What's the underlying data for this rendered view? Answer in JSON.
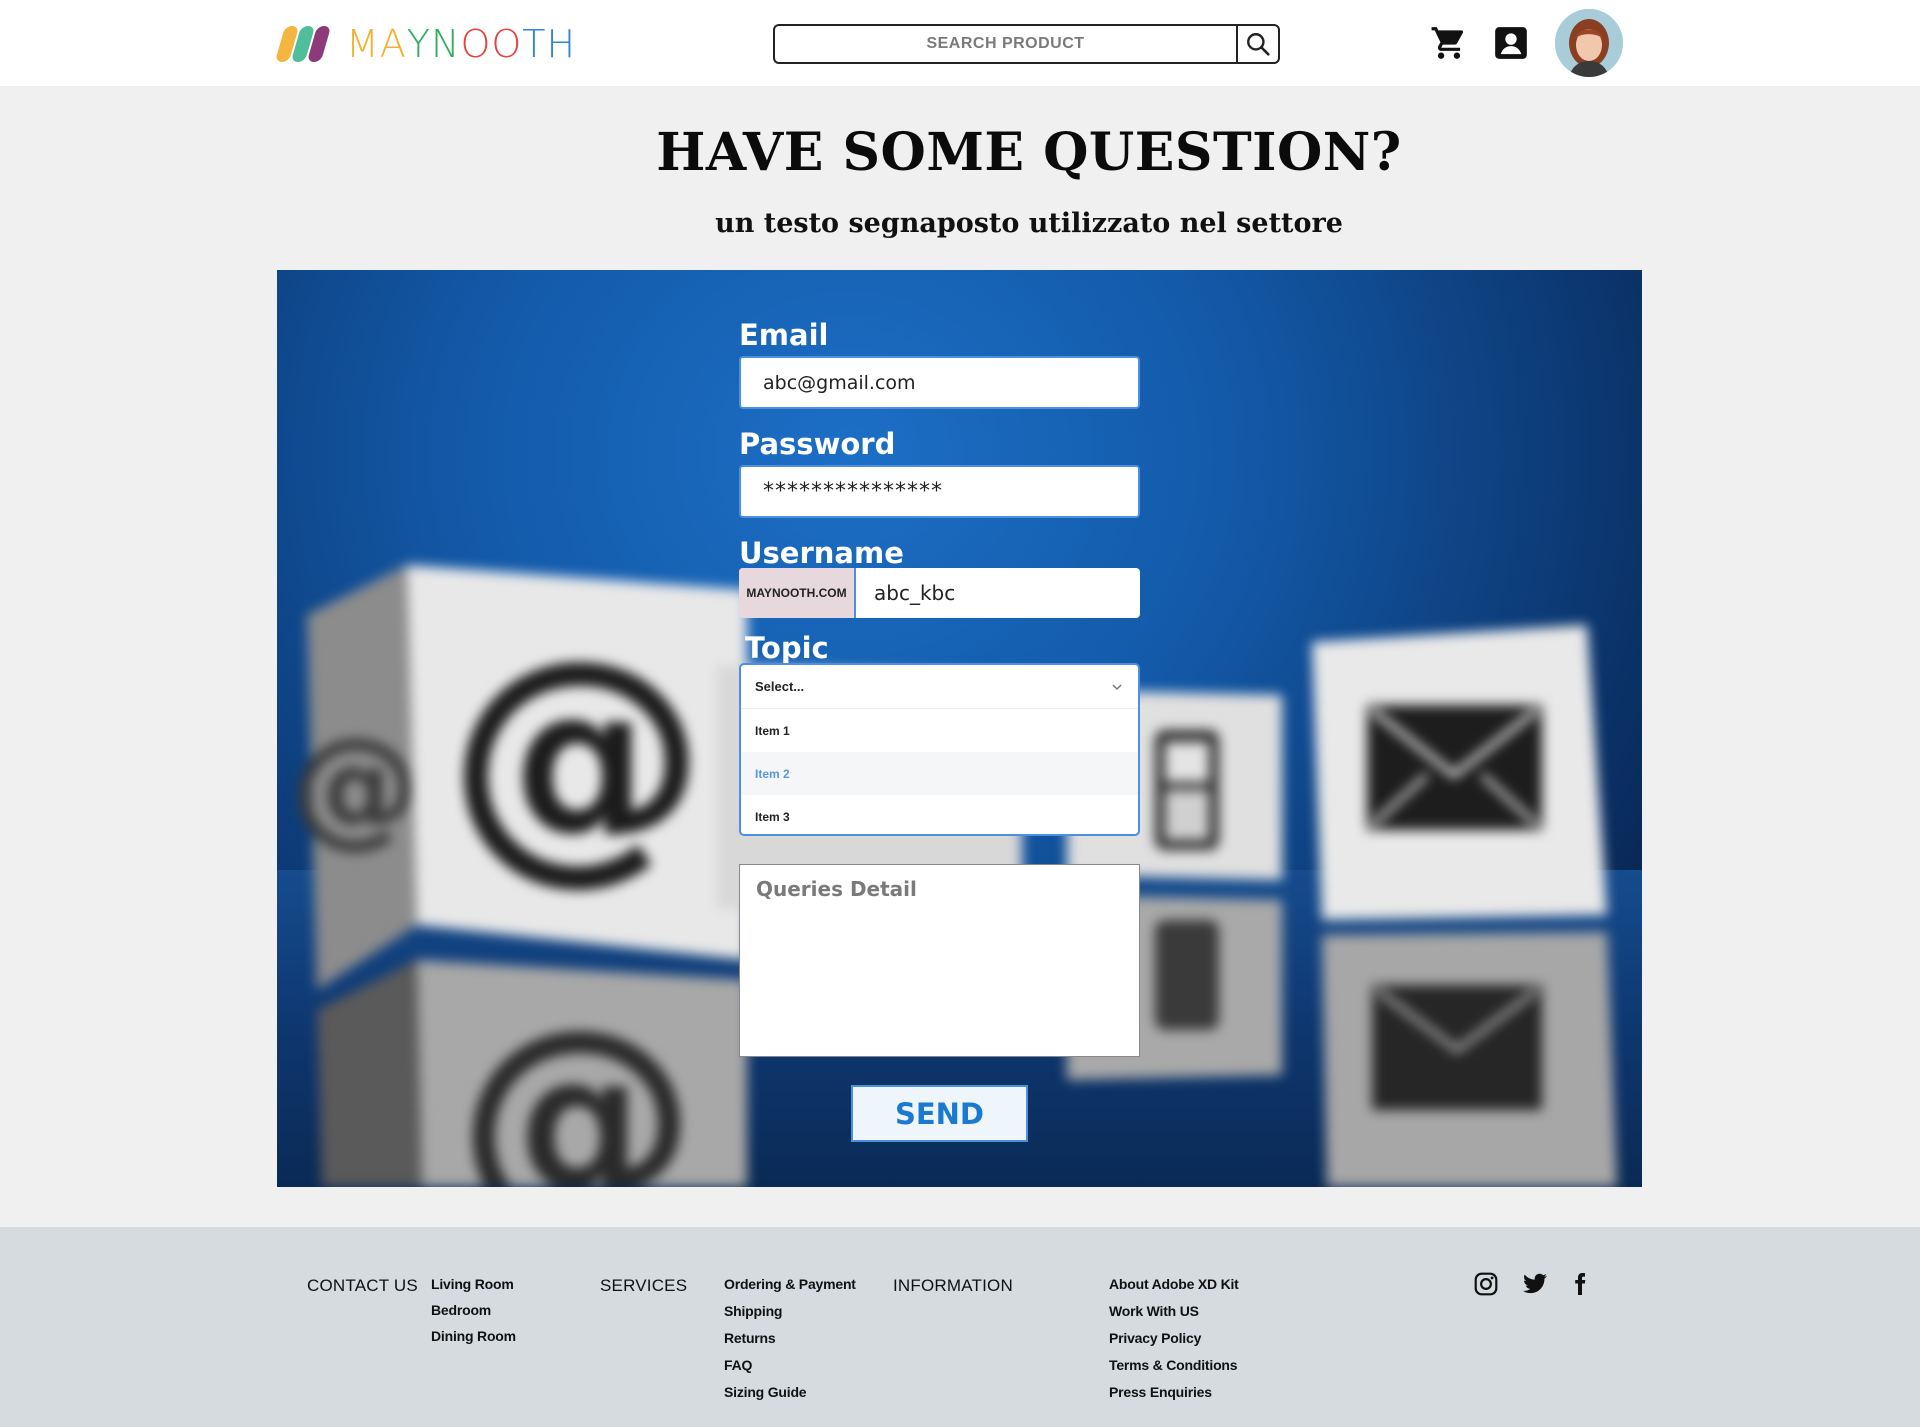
{
  "brand": {
    "name_letters": [
      "M",
      "A",
      "Y",
      "N",
      "O",
      "O",
      "T",
      "H"
    ],
    "letter_colors": [
      "#f2b230",
      "#f2b230",
      "#2fae5e",
      "#2fae5e",
      "#e4433d",
      "#e4433d",
      "#2f86d6",
      "#2f86d6"
    ]
  },
  "header": {
    "search_placeholder": "SEARCH PRODUCT",
    "icons": [
      "search-icon",
      "cart-icon",
      "account-icon",
      "avatar"
    ]
  },
  "hero": {
    "title": "HAVE SOME QUESTION?",
    "subtitle": "un testo segnaposto utilizzato nel settore"
  },
  "form": {
    "email_label": "Email",
    "email_value": "abc@gmail.com",
    "password_label": "Password",
    "password_value": "***************",
    "username_label": "Username",
    "username_prefix": "MAYNOOTH.COM",
    "username_value": "abc_kbc",
    "topic_label": "Topic",
    "topic_placeholder": "Select...",
    "topic_options": [
      "Item 1",
      "Item 2",
      "Item 3"
    ],
    "topic_highlighted": "Item 2",
    "queries_placeholder": "Queries Detail",
    "send_label": "SEND"
  },
  "footer": {
    "contact_heading": "CONTACT US",
    "contact_links": [
      "Living Room",
      "Bedroom",
      "Dining Room"
    ],
    "services_heading": "SERVICES",
    "services_links": [
      "Ordering & Payment",
      "Shipping",
      "Returns",
      "FAQ",
      "Sizing Guide"
    ],
    "information_heading": "INFORMATION",
    "information_links": [
      "About Adobe XD Kit",
      "Work With US",
      "Privacy Policy",
      "Terms & Conditions",
      "Press Enquiries"
    ],
    "social": [
      "instagram-icon",
      "twitter-icon",
      "facebook-icon"
    ]
  },
  "colors": {
    "accent": "#4d8fe0",
    "send_text": "#1a7ad0",
    "footer_bg": "#d5dbdf",
    "page_bg": "#f0f0f0"
  }
}
